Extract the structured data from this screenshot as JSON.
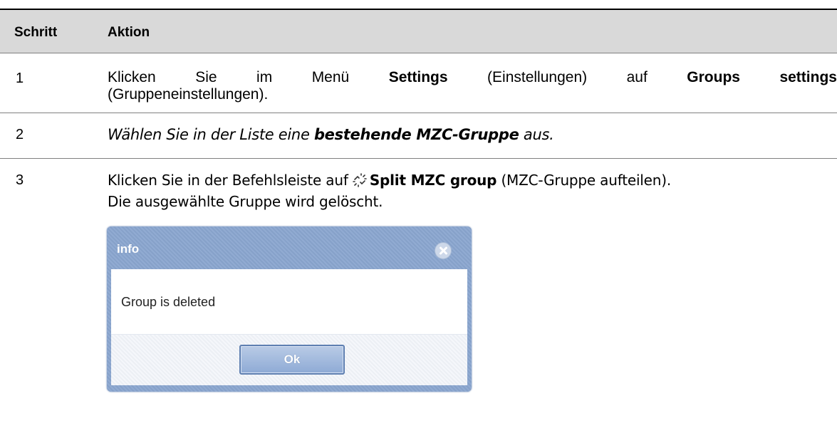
{
  "table": {
    "header": {
      "step": "Schritt",
      "action": "Aktion"
    },
    "rows": [
      {
        "step": "1",
        "line1": {
          "w1": "Klicken",
          "w2": "Sie",
          "w3": "im",
          "w4": "Menü",
          "w5": "Settings",
          "w6": "(Einstellungen)",
          "w7": "auf",
          "w8": "Groups",
          "w9": "settings"
        },
        "line2": "(Gruppeneinstellungen)."
      },
      {
        "step": "2",
        "text_before": "Wählen Sie in der Liste eine ",
        "text_bold": "bestehende MZC-Gruppe",
        "text_after": " aus."
      },
      {
        "step": "3",
        "line1_before": "Klicken Sie in der Befehlsleiste auf ",
        "line1_icon": "split-group-icon",
        "line1_bold": "Split MZC group",
        "line1_after": " (MZC-Gruppe aufteilen).",
        "line2": "Die ausgewählte Gruppe wird gelöscht."
      }
    ]
  },
  "dialog": {
    "title": "info",
    "close_icon": "close-circle-icon",
    "message": "Group is deleted",
    "ok_label": "Ok"
  },
  "colors": {
    "header_bg": "#d9d9d9",
    "dialog_frame": "#8aa6cf",
    "ok_button": "#8eaad5"
  }
}
